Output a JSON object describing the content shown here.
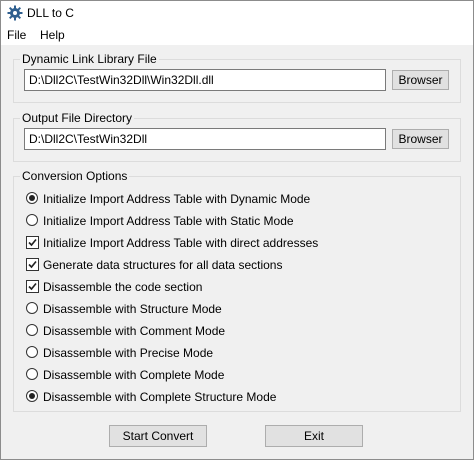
{
  "window": {
    "title": "DLL to C",
    "icon": "gear-icon"
  },
  "menu": [
    "File",
    "Help"
  ],
  "dll_group": {
    "label": "Dynamic Link Library File",
    "value": "D:\\Dll2C\\TestWin32Dll\\Win32Dll.dll",
    "browse_label": "Browser"
  },
  "output_group": {
    "label": "Output File Directory",
    "value": "D:\\Dll2C\\TestWin32Dll",
    "browse_label": "Browser"
  },
  "options_group": {
    "label": "Conversion Options",
    "options": [
      {
        "label": "Initialize Import Address Table with Dynamic Mode",
        "type": "radio",
        "checked": true
      },
      {
        "label": "Initialize Import Address Table with Static Mode",
        "type": "radio",
        "checked": false
      },
      {
        "label": "Initialize Import Address Table with direct addresses",
        "type": "checkbox",
        "checked": true
      },
      {
        "label": "Generate data structures for all data sections",
        "type": "checkbox",
        "checked": true
      },
      {
        "label": "Disassemble the code section",
        "type": "checkbox",
        "checked": true
      },
      {
        "label": "Disassemble with Structure Mode",
        "type": "radio",
        "checked": false
      },
      {
        "label": "Disassemble with Comment Mode",
        "type": "radio",
        "checked": false
      },
      {
        "label": "Disassemble with Precise Mode",
        "type": "radio",
        "checked": false
      },
      {
        "label": "Disassemble with Complete Mode",
        "type": "radio",
        "checked": false
      },
      {
        "label": "Disassemble with Complete Structure Mode",
        "type": "radio",
        "checked": true
      }
    ]
  },
  "buttons": {
    "start": "Start Convert",
    "exit": "Exit"
  }
}
